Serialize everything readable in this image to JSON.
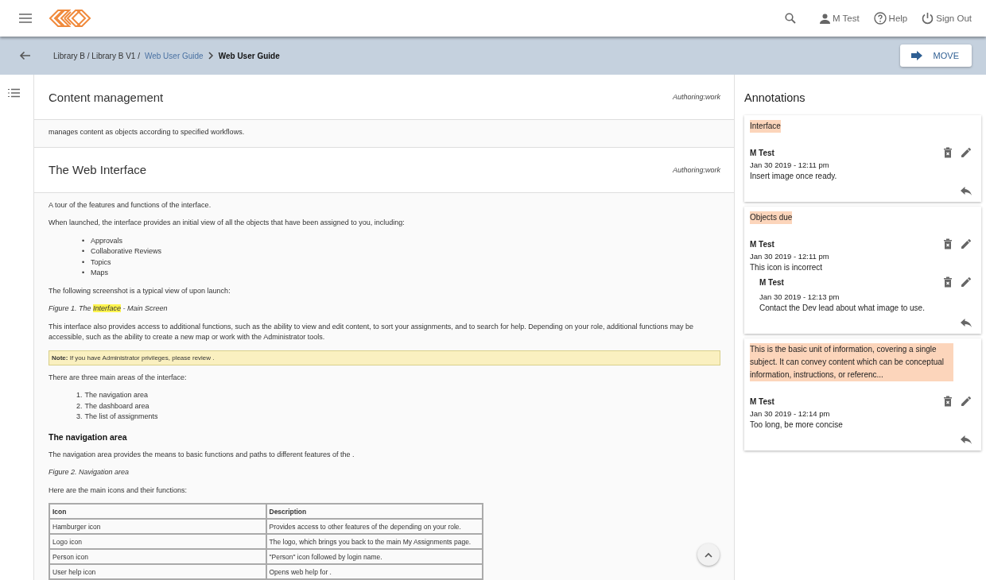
{
  "header": {
    "user": "M Test",
    "help": "Help",
    "sign_out": "Sign Out"
  },
  "breadcrumb": {
    "path": "Library B / Library B V1 /",
    "link": "Web User Guide",
    "current": "Web User Guide"
  },
  "move_button": "MOVE",
  "sections": [
    {
      "title": "Content management",
      "status": "Authoring:work",
      "blocks": [
        {
          "kind": "p",
          "text": "manages content as objects according to specified workflows."
        }
      ]
    },
    {
      "title": "The Web Interface",
      "status": "Authoring:work",
      "blocks": [
        {
          "kind": "p",
          "text": "A tour of the features and functions of the interface."
        },
        {
          "kind": "p",
          "text": "When launched, the interface provides an initial view of all the objects that have been assigned to you, including:"
        },
        {
          "kind": "ul",
          "items": [
            {
              "marker": "•",
              "text": "Approvals"
            },
            {
              "marker": "•",
              "text": "Collaborative Reviews"
            },
            {
              "marker": "•",
              "text": "Topics"
            },
            {
              "marker": "•",
              "text": "Maps"
            }
          ]
        },
        {
          "kind": "p",
          "text": "The following screenshot is a typical view of upon launch:"
        },
        {
          "kind": "figure",
          "before": "Figure 1. The ",
          "highlight": "Interface",
          "after": " - Main Screen"
        },
        {
          "kind": "p",
          "text": "This interface also provides access to additional functions, such as the ability to view and edit content, to sort your assignments, and to search for help. Depending on your role, additional functions may be accessible, such as the ability to create a new map or work with the Administrator tools."
        },
        {
          "kind": "note",
          "text": "**Note:** If you have Administrator privileges, please review ."
        },
        {
          "kind": "p",
          "text": "There are three main areas of the interface:"
        },
        {
          "kind": "ol",
          "items": [
            {
              "marker": "1.",
              "text": "The navigation area"
            },
            {
              "marker": "2.",
              "text": "The dashboard area"
            },
            {
              "marker": "3.",
              "text": "The list of assignments"
            }
          ]
        },
        {
          "kind": "h",
          "text": "The navigation area"
        },
        {
          "kind": "p",
          "text": "The navigation area provides the means to basic functions and paths to different features of the ."
        },
        {
          "kind": "figure",
          "before": "Figure 2. Navigation area"
        },
        {
          "kind": "p",
          "text": "Here are the main icons and their functions:"
        },
        {
          "kind": "table",
          "columns": [
            "Icon",
            "Description"
          ],
          "rows": [
            [
              "Hamburger icon",
              "Provides access to other features of the depending on your role."
            ],
            [
              "Logo icon",
              "The logo, which brings you back to the main My Assignments page."
            ],
            [
              "Person icon",
              "\"Person\" icon followed by login name."
            ],
            [
              "User help icon",
              "Opens web help for ."
            ]
          ]
        }
      ]
    }
  ],
  "annotations": {
    "title": "Annotations",
    "items": [
      {
        "quote": "Interface",
        "comments": [
          {
            "author": "M Test",
            "date": "Jan 30 2019 - 12:11 pm",
            "text": "Insert image once ready."
          }
        ]
      },
      {
        "quote": "Objects due",
        "comments": [
          {
            "author": "M Test",
            "date": "Jan 30 2019 - 12:11 pm",
            "text": "This icon is incorrect",
            "replies": [
              {
                "author": "M Test",
                "date": "Jan 30 2019 - 12:13 pm",
                "text": "Contact the Dev lead about what image to use."
              }
            ]
          }
        ]
      },
      {
        "quote": "This is the basic unit of information, covering a single subject. It can convey content which can be conceptual information, instructions, or referenc...",
        "comments": [
          {
            "author": "M Test",
            "date": "Jan 30 2019 - 12:14 pm",
            "text": "Too long, be more concise"
          }
        ]
      }
    ]
  }
}
